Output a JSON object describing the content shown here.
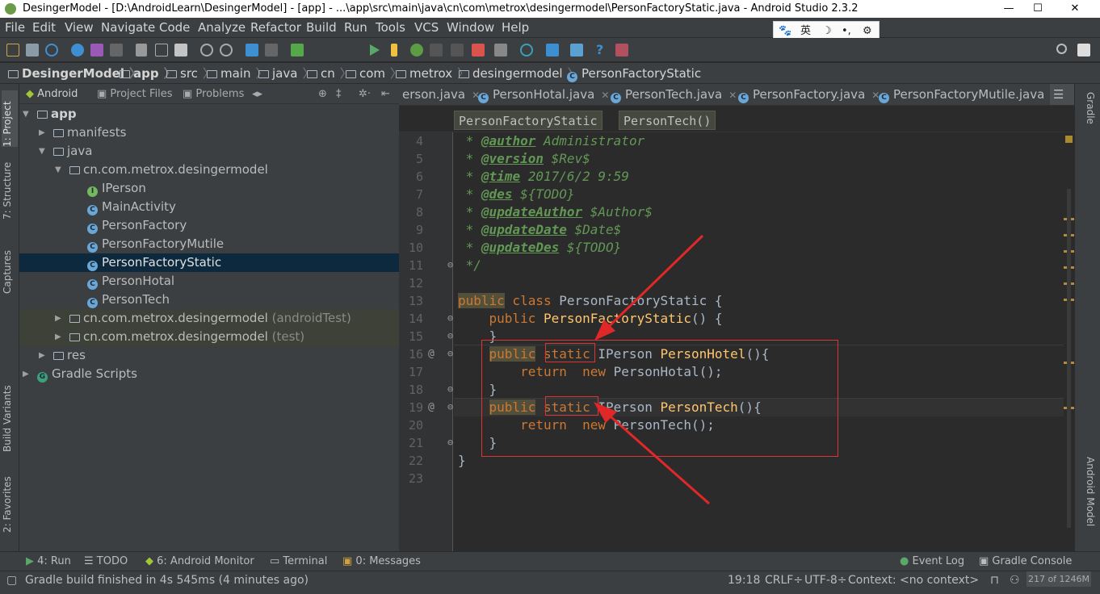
{
  "window": {
    "title": "DesingerModel - [D:\\AndroidLearn\\DesingerModel] - [app] - ...\\app\\src\\main\\java\\cn\\com\\metrox\\desingermodel\\PersonFactoryStatic.java - Android Studio 2.3.2",
    "minimize": "—",
    "maximize": "☐",
    "close": "✕"
  },
  "menu": [
    "File",
    "Edit",
    "View",
    "Navigate",
    "Code",
    "Analyze",
    "Refactor",
    "Build",
    "Run",
    "Tools",
    "VCS",
    "Window",
    "Help"
  ],
  "ime": {
    "paw": "🐾",
    "lang": "英",
    "moon": "☽",
    "punct": "•,",
    "gear": "⚙"
  },
  "toolbar": {
    "run_config": "app"
  },
  "breadcrumb": [
    "DesingerModel",
    "app",
    "src",
    "main",
    "java",
    "cn",
    "com",
    "metrox",
    "desingermodel",
    "PersonFactoryStatic"
  ],
  "left_tools": {
    "project": "1: Project",
    "structure": "7: Structure",
    "captures": "Captures",
    "build_variants": "Build Variants",
    "favorites": "2: Favorites"
  },
  "right_tools": {
    "gradle": "Gradle",
    "android_model": "Android Model"
  },
  "project_panel": {
    "tabs": [
      "Android",
      "Project Files",
      "Problems"
    ]
  },
  "tree": [
    {
      "label": "app",
      "extra": ""
    },
    {
      "label": "manifests",
      "extra": ""
    },
    {
      "label": "java",
      "extra": ""
    },
    {
      "label": "cn.com.metrox.desingermodel",
      "extra": ""
    },
    {
      "label": "IPerson",
      "extra": ""
    },
    {
      "label": "MainActivity",
      "extra": ""
    },
    {
      "label": "PersonFactory",
      "extra": ""
    },
    {
      "label": "PersonFactoryMutile",
      "extra": ""
    },
    {
      "label": "PersonFactoryStatic",
      "extra": ""
    },
    {
      "label": "PersonHotal",
      "extra": ""
    },
    {
      "label": "PersonTech",
      "extra": ""
    },
    {
      "label": "cn.com.metrox.desingermodel",
      "extra": " (androidTest)"
    },
    {
      "label": "cn.com.metrox.desingermodel",
      "extra": " (test)"
    },
    {
      "label": "res",
      "extra": ""
    },
    {
      "label": "Gradle Scripts",
      "extra": ""
    }
  ],
  "editor_tabs": [
    "erson.java",
    "PersonHotal.java",
    "PersonTech.java",
    "PersonFactory.java",
    "PersonFactoryMutile.java"
  ],
  "editor_breadcrumb": [
    "PersonFactoryStatic",
    "PersonTech()"
  ],
  "code": {
    "line_numbers": [
      "4",
      "5",
      "6",
      "7",
      "8",
      "9",
      "10",
      "11",
      "12",
      "13",
      "14",
      "15",
      "16",
      "17",
      "18",
      "19",
      "20",
      "21",
      "22",
      "23"
    ],
    "l4": {
      "star": " * ",
      "tag": "@author",
      "text": " Administrator"
    },
    "l5": {
      "star": " * ",
      "tag": "@version",
      "text": " $Rev$"
    },
    "l6": {
      "star": " * ",
      "tag": "@time",
      "text": " 2017/6/2 9:59"
    },
    "l7": {
      "star": " * ",
      "tag": "@des",
      "text": " ${TODO}"
    },
    "l8": {
      "star": " * ",
      "tag": "@updateAuthor",
      "text": " $Author$"
    },
    "l9": {
      "star": " * ",
      "tag": "@updateDate",
      "text": " $Date$"
    },
    "l10": {
      "star": " * ",
      "tag": "@updateDes",
      "text": " ${TODO}"
    },
    "l11": " */",
    "l13": {
      "kw1": "public",
      "kw2": " class ",
      "name": "PersonFactoryStatic {"
    },
    "l14": {
      "indent": "    ",
      "kw": "public ",
      "name": "PersonFactoryStatic",
      "rest": "() {"
    },
    "l15": "    }",
    "l16": {
      "indent": "    ",
      "kw1": "public",
      "sp": " ",
      "kw2": "static",
      "type": " IPerson ",
      "fn": "PersonHotel",
      "rest": "(){"
    },
    "l17": {
      "indent": "        ",
      "kw1": "return",
      "sp": "  ",
      "kw2": "new",
      "rest": " PersonHotal();"
    },
    "l18": "    }",
    "l19": {
      "indent": "    ",
      "kw1": "public",
      "sp": " ",
      "kw2": "static",
      "type": " IPerson ",
      "fn": "PersonTech",
      "rest": "(){"
    },
    "l20": {
      "indent": "        ",
      "kw1": "return",
      "sp": "  ",
      "kw2": "new",
      "rest": " PersonTech();"
    },
    "l21": "    }",
    "l22": "}"
  },
  "bottom_tools": {
    "run": "4: Run",
    "todo": "TODO",
    "monitor": "6: Android Monitor",
    "terminal": "Terminal",
    "messages": "0: Messages",
    "event_log": "Event Log",
    "gradle_console": "Gradle Console"
  },
  "status": {
    "message": "Gradle build finished in 4s 545ms (4 minutes ago)",
    "position": "19:18",
    "line_sep": "CRLF÷",
    "encoding": "UTF-8÷",
    "context": "Context: <no context>",
    "memory": "217 of 1246M"
  },
  "colors": {
    "keyword": "#cc7832",
    "comment": "#629755",
    "function": "#ffc66d",
    "annotation_box": "#e03333",
    "selection": "#0d293e"
  }
}
